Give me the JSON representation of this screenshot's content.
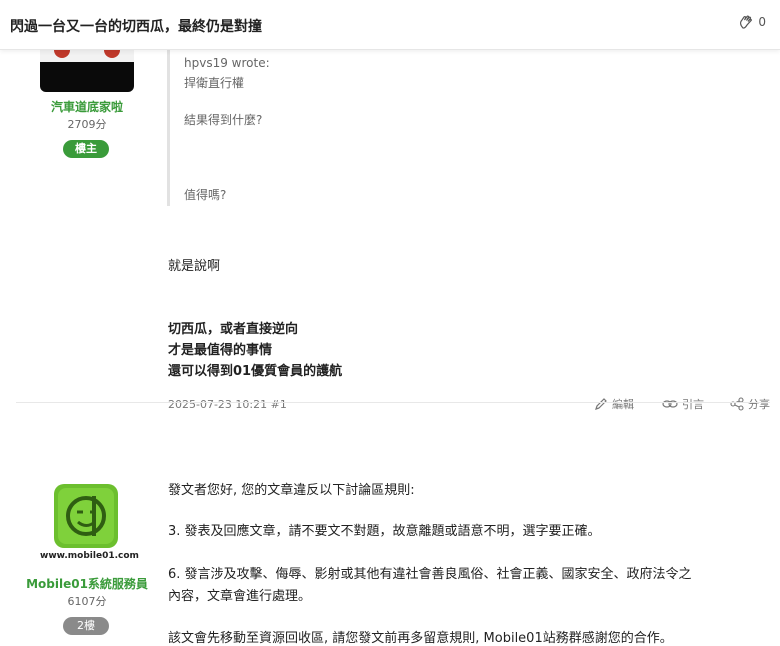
{
  "header": {
    "title": "閃過一台又一台的切西瓜，最終仍是對撞",
    "like_count": "0"
  },
  "post1": {
    "username": "汽車道底家啦",
    "score": "2709分",
    "role": "樓主",
    "quote": {
      "author": "hpvs19 wrote:",
      "line1": "捍衛直行權",
      "line2": "結果得到什麼?",
      "line3": "值得嗎?"
    },
    "body": {
      "line1": "就是說啊",
      "bold1": "切西瓜，或者直接逆向",
      "bold2": "才是最值得的事情",
      "bold3": "還可以得到01優質會員的護航"
    },
    "timestamp": "2025-07-23 10:21 #1",
    "actions": {
      "edit": "編輯",
      "quote": "引言",
      "share": "分享"
    }
  },
  "post2": {
    "username": "Mobile01系統服務員",
    "score": "6107分",
    "floor": "2樓",
    "avatar_caption": "www.mobile01.com",
    "rules": {
      "intro": "發文者您好, 您的文章違反以下討論區規則:",
      "rule3": "3. 發表及回應文章，請不要文不對題，故意離題或語意不明，選字要正確。",
      "rule6a": "6. 發言涉及攻擊、侮辱、影射或其他有違社會善良風俗、社會正義、國家安全、政府法令之",
      "rule6b": "內容，文章會進行處理。",
      "closing": "該文會先移動至資源回收區, 請您發文前再多留意規則, Mobile01站務群感謝您的合作。"
    }
  },
  "colors": {
    "green": "#3a9b3a",
    "gray_pill": "#8a8a8a",
    "logo_green": "#6cbf2e"
  }
}
